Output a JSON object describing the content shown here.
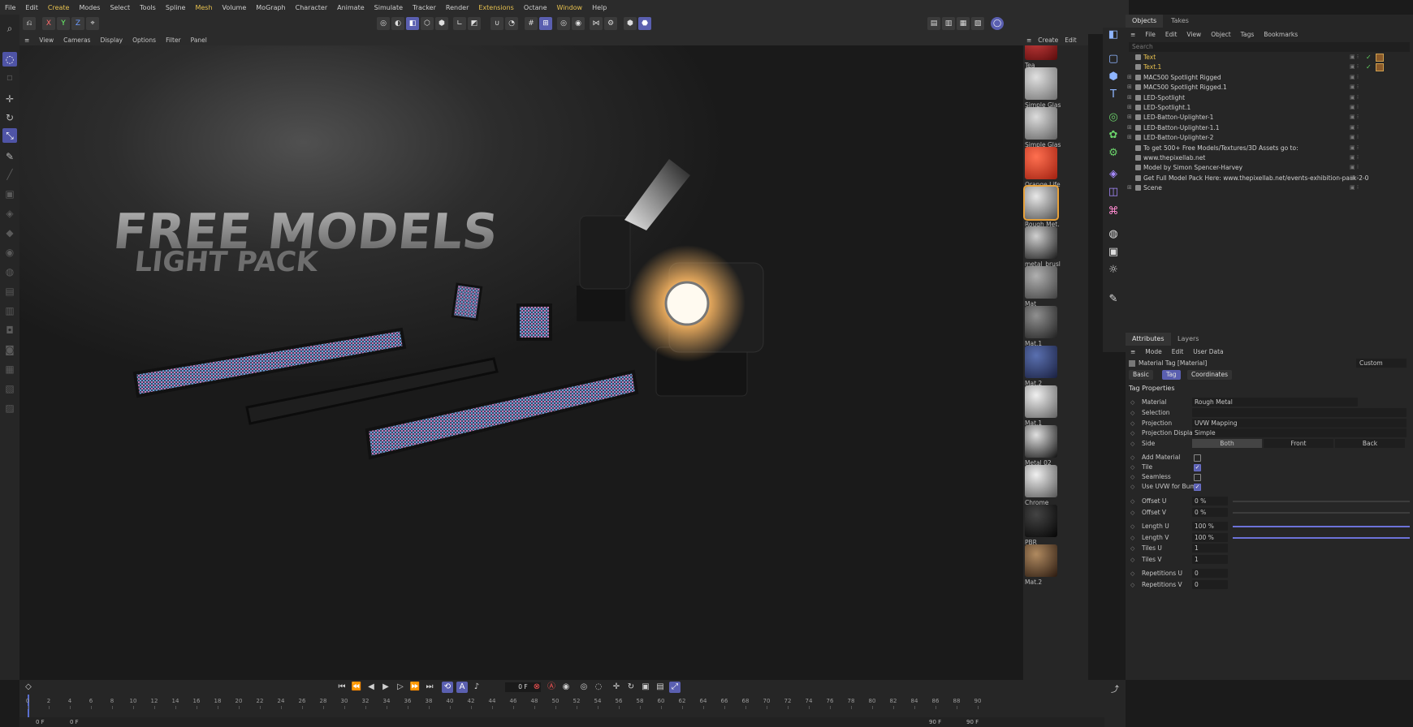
{
  "menubar": [
    "File",
    "Edit",
    "Create",
    "Modes",
    "Select",
    "Tools",
    "Spline",
    "Mesh",
    "Volume",
    "MoGraph",
    "Character",
    "Animate",
    "Simulate",
    "Tracker",
    "Render",
    "Extensions",
    "Octane",
    "Window",
    "Help"
  ],
  "menubar_highlight": [
    "Create",
    "Mesh",
    "Extensions",
    "Window"
  ],
  "toolbar_axes": [
    "X",
    "Y",
    "Z"
  ],
  "viewport_menu": [
    "View",
    "Cameras",
    "Display",
    "Options",
    "Filter",
    "Panel"
  ],
  "material_menu": [
    "Create",
    "Edit"
  ],
  "materials": [
    "Tea",
    "Simple Glas",
    "Simple Glas",
    "Orange Life",
    "Rough Met.",
    "metal_brusl",
    "Mat",
    "Mat.1",
    "Mat.2",
    "Mat.1",
    "Metal 02",
    "Chrome",
    "PBR",
    "Mat.2"
  ],
  "scene": {
    "title_line1": "FREE MODELS",
    "title_line2": "LIGHT PACK"
  },
  "objects_panel": {
    "tabs": [
      "Objects",
      "Takes"
    ],
    "menu": [
      "File",
      "Edit",
      "View",
      "Object",
      "Tags",
      "Bookmarks"
    ],
    "search_placeholder": "Search",
    "rows": [
      {
        "name": "Text",
        "highlight": true,
        "expand": false
      },
      {
        "name": "Text.1",
        "highlight": true,
        "expand": false
      },
      {
        "name": "MAC500 Spotlight Rigged",
        "highlight": false,
        "expand": true
      },
      {
        "name": "MAC500 Spotlight Rigged.1",
        "highlight": false,
        "expand": true
      },
      {
        "name": "LED-Spotlight",
        "highlight": false,
        "expand": true
      },
      {
        "name": "LED-Spotlight.1",
        "highlight": false,
        "expand": true
      },
      {
        "name": "LED-Batton-Uplighter-1",
        "highlight": false,
        "expand": true
      },
      {
        "name": "LED-Batton-Uplighter-1.1",
        "highlight": false,
        "expand": true
      },
      {
        "name": "LED-Batton-Uplighter-2",
        "highlight": false,
        "expand": true
      },
      {
        "name": "To get 500+ Free Models/Textures/3D Assets go to:",
        "highlight": false,
        "expand": false
      },
      {
        "name": "www.thepixellab.net",
        "highlight": false,
        "expand": false
      },
      {
        "name": "Model by Simon Spencer-Harvey",
        "highlight": false,
        "expand": false
      },
      {
        "name": "Get Full Model Pack Here: www.thepixellab.net/events-exhibition-pack-2-0",
        "highlight": false,
        "expand": false
      },
      {
        "name": "Scene",
        "highlight": false,
        "expand": true
      }
    ]
  },
  "attributes_panel": {
    "tabs": [
      "Attributes",
      "Layers"
    ],
    "menu": [
      "Mode",
      "Edit",
      "User Data"
    ],
    "preset": "Custom",
    "object_title": "Material Tag [Material]",
    "subtabs": [
      "Basic",
      "Tag",
      "Coordinates"
    ],
    "active_subtab": "Tag",
    "section": "Tag Properties",
    "material_label": "Material",
    "material_value": "Rough Metal",
    "selection_label": "Selection",
    "projection_label": "Projection",
    "projection_value": "UVW Mapping",
    "projection_display_label": "Projection Display",
    "projection_display_value": "Simple",
    "side_label": "Side",
    "side_options": [
      "Both",
      "Front",
      "Back"
    ],
    "side_selected": "Both",
    "checks": [
      {
        "label": "Add Material",
        "on": false
      },
      {
        "label": "Tile",
        "on": true
      },
      {
        "label": "Seamless",
        "on": false
      },
      {
        "label": "Use UVW for Bump",
        "on": true
      }
    ],
    "fields": [
      {
        "label": "Offset U",
        "value": "0 %",
        "slider": 0.0
      },
      {
        "label": "Offset V",
        "value": "0 %",
        "slider": 0.0
      },
      {
        "label": "Length U",
        "value": "100 %",
        "slider": 1.0
      },
      {
        "label": "Length V",
        "value": "100 %",
        "slider": 1.0
      },
      {
        "label": "Tiles U",
        "value": "1"
      },
      {
        "label": "Tiles V",
        "value": "1"
      },
      {
        "label": "Repetitions U",
        "value": "0"
      },
      {
        "label": "Repetitions V",
        "value": "0"
      }
    ]
  },
  "timeline": {
    "current_frame": "0 F",
    "ticks": [
      "0",
      "2",
      "4",
      "6",
      "8",
      "10",
      "12",
      "14",
      "16",
      "18",
      "20",
      "22",
      "24",
      "26",
      "28",
      "30",
      "32",
      "34",
      "36",
      "38",
      "40",
      "42",
      "44",
      "46",
      "48",
      "50",
      "52",
      "54",
      "56",
      "58",
      "60",
      "62",
      "64",
      "66",
      "68",
      "70",
      "72",
      "74",
      "76",
      "78",
      "80",
      "82",
      "84",
      "86",
      "88",
      "90"
    ],
    "start": "0 F",
    "min": "0 F",
    "max": "90 F",
    "end": "90 F"
  },
  "colors": {
    "accent": "#5a5fb0",
    "highlight": "#e6c04f",
    "panel": "#262626",
    "viewport": "#1a1a1a"
  }
}
